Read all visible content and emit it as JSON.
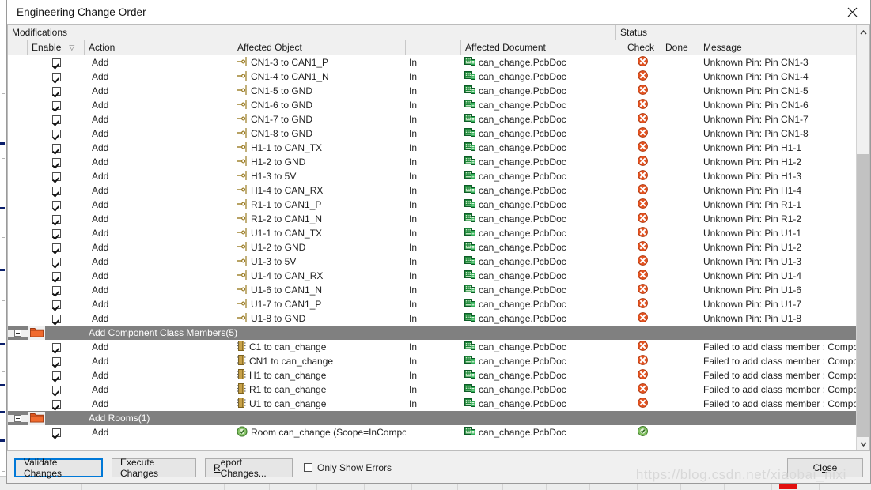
{
  "window": {
    "title": "Engineering Change Order",
    "close_icon": "close-icon"
  },
  "grid": {
    "group_headers": [
      {
        "label": "Modifications"
      },
      {
        "label": "Status"
      }
    ],
    "columns": [
      {
        "key": "enable",
        "label": "Enable",
        "sort_indicator": "▽"
      },
      {
        "key": "action",
        "label": "Action"
      },
      {
        "key": "object",
        "label": "Affected Object"
      },
      {
        "key": "in",
        "label": ""
      },
      {
        "key": "document",
        "label": "Affected Document"
      },
      {
        "key": "check",
        "label": "Check"
      },
      {
        "key": "done",
        "label": "Done"
      },
      {
        "key": "message",
        "label": "Message"
      }
    ],
    "scrollbar": {
      "up_arrow": "chevron-up-icon",
      "down_arrow": "chevron-down-icon"
    },
    "rows": [
      {
        "type": "item",
        "enabled": true,
        "action": "Add",
        "object_icon": "net-pin-icon",
        "object": "CN1-3 to CAN1_P",
        "in": "In",
        "doc_icon": "pcbdoc-icon",
        "document": "can_change.PcbDoc",
        "check": "error-icon",
        "done": "",
        "message": "Unknown Pin: Pin CN1-3"
      },
      {
        "type": "item",
        "enabled": true,
        "action": "Add",
        "object_icon": "net-pin-icon",
        "object": "CN1-4 to CAN1_N",
        "in": "In",
        "doc_icon": "pcbdoc-icon",
        "document": "can_change.PcbDoc",
        "check": "error-icon",
        "done": "",
        "message": "Unknown Pin: Pin CN1-4"
      },
      {
        "type": "item",
        "enabled": true,
        "action": "Add",
        "object_icon": "net-pin-icon",
        "object": "CN1-5 to GND",
        "in": "In",
        "doc_icon": "pcbdoc-icon",
        "document": "can_change.PcbDoc",
        "check": "error-icon",
        "done": "",
        "message": "Unknown Pin: Pin CN1-5"
      },
      {
        "type": "item",
        "enabled": true,
        "action": "Add",
        "object_icon": "net-pin-icon",
        "object": "CN1-6 to GND",
        "in": "In",
        "doc_icon": "pcbdoc-icon",
        "document": "can_change.PcbDoc",
        "check": "error-icon",
        "done": "",
        "message": "Unknown Pin: Pin CN1-6"
      },
      {
        "type": "item",
        "enabled": true,
        "action": "Add",
        "object_icon": "net-pin-icon",
        "object": "CN1-7 to GND",
        "in": "In",
        "doc_icon": "pcbdoc-icon",
        "document": "can_change.PcbDoc",
        "check": "error-icon",
        "done": "",
        "message": "Unknown Pin: Pin CN1-7"
      },
      {
        "type": "item",
        "enabled": true,
        "action": "Add",
        "object_icon": "net-pin-icon",
        "object": "CN1-8 to GND",
        "in": "In",
        "doc_icon": "pcbdoc-icon",
        "document": "can_change.PcbDoc",
        "check": "error-icon",
        "done": "",
        "message": "Unknown Pin: Pin CN1-8"
      },
      {
        "type": "item",
        "enabled": true,
        "action": "Add",
        "object_icon": "net-pin-icon",
        "object": "H1-1 to CAN_TX",
        "in": "In",
        "doc_icon": "pcbdoc-icon",
        "document": "can_change.PcbDoc",
        "check": "error-icon",
        "done": "",
        "message": "Unknown Pin: Pin H1-1"
      },
      {
        "type": "item",
        "enabled": true,
        "action": "Add",
        "object_icon": "net-pin-icon",
        "object": "H1-2 to GND",
        "in": "In",
        "doc_icon": "pcbdoc-icon",
        "document": "can_change.PcbDoc",
        "check": "error-icon",
        "done": "",
        "message": "Unknown Pin: Pin H1-2"
      },
      {
        "type": "item",
        "enabled": true,
        "action": "Add",
        "object_icon": "net-pin-icon",
        "object": "H1-3 to 5V",
        "in": "In",
        "doc_icon": "pcbdoc-icon",
        "document": "can_change.PcbDoc",
        "check": "error-icon",
        "done": "",
        "message": "Unknown Pin: Pin H1-3"
      },
      {
        "type": "item",
        "enabled": true,
        "action": "Add",
        "object_icon": "net-pin-icon",
        "object": "H1-4 to CAN_RX",
        "in": "In",
        "doc_icon": "pcbdoc-icon",
        "document": "can_change.PcbDoc",
        "check": "error-icon",
        "done": "",
        "message": "Unknown Pin: Pin H1-4"
      },
      {
        "type": "item",
        "enabled": true,
        "action": "Add",
        "object_icon": "net-pin-icon",
        "object": "R1-1 to CAN1_P",
        "in": "In",
        "doc_icon": "pcbdoc-icon",
        "document": "can_change.PcbDoc",
        "check": "error-icon",
        "done": "",
        "message": "Unknown Pin: Pin R1-1"
      },
      {
        "type": "item",
        "enabled": true,
        "action": "Add",
        "object_icon": "net-pin-icon",
        "object": "R1-2 to CAN1_N",
        "in": "In",
        "doc_icon": "pcbdoc-icon",
        "document": "can_change.PcbDoc",
        "check": "error-icon",
        "done": "",
        "message": "Unknown Pin: Pin R1-2"
      },
      {
        "type": "item",
        "enabled": true,
        "action": "Add",
        "object_icon": "net-pin-icon",
        "object": "U1-1 to CAN_TX",
        "in": "In",
        "doc_icon": "pcbdoc-icon",
        "document": "can_change.PcbDoc",
        "check": "error-icon",
        "done": "",
        "message": "Unknown Pin: Pin U1-1"
      },
      {
        "type": "item",
        "enabled": true,
        "action": "Add",
        "object_icon": "net-pin-icon",
        "object": "U1-2 to GND",
        "in": "In",
        "doc_icon": "pcbdoc-icon",
        "document": "can_change.PcbDoc",
        "check": "error-icon",
        "done": "",
        "message": "Unknown Pin: Pin U1-2"
      },
      {
        "type": "item",
        "enabled": true,
        "action": "Add",
        "object_icon": "net-pin-icon",
        "object": "U1-3 to 5V",
        "in": "In",
        "doc_icon": "pcbdoc-icon",
        "document": "can_change.PcbDoc",
        "check": "error-icon",
        "done": "",
        "message": "Unknown Pin: Pin U1-3"
      },
      {
        "type": "item",
        "enabled": true,
        "action": "Add",
        "object_icon": "net-pin-icon",
        "object": "U1-4 to CAN_RX",
        "in": "In",
        "doc_icon": "pcbdoc-icon",
        "document": "can_change.PcbDoc",
        "check": "error-icon",
        "done": "",
        "message": "Unknown Pin: Pin U1-4"
      },
      {
        "type": "item",
        "enabled": true,
        "action": "Add",
        "object_icon": "net-pin-icon",
        "object": "U1-6 to CAN1_N",
        "in": "In",
        "doc_icon": "pcbdoc-icon",
        "document": "can_change.PcbDoc",
        "check": "error-icon",
        "done": "",
        "message": "Unknown Pin: Pin U1-6"
      },
      {
        "type": "item",
        "enabled": true,
        "action": "Add",
        "object_icon": "net-pin-icon",
        "object": "U1-7 to CAN1_P",
        "in": "In",
        "doc_icon": "pcbdoc-icon",
        "document": "can_change.PcbDoc",
        "check": "error-icon",
        "done": "",
        "message": "Unknown Pin: Pin U1-7"
      },
      {
        "type": "item",
        "enabled": true,
        "action": "Add",
        "object_icon": "net-pin-icon",
        "object": "U1-8 to GND",
        "in": "In",
        "doc_icon": "pcbdoc-icon",
        "document": "can_change.PcbDoc",
        "check": "error-icon",
        "done": "",
        "message": "Unknown Pin: Pin U1-8"
      },
      {
        "type": "group",
        "expander": "collapse-icon",
        "folder_icon": "folder-icon",
        "label": "Add Component Class Members(5)"
      },
      {
        "type": "item",
        "enabled": true,
        "action": "Add",
        "object_icon": "component-icon",
        "object": "C1 to can_change",
        "in": "In",
        "doc_icon": "pcbdoc-icon",
        "document": "can_change.PcbDoc",
        "check": "error-icon",
        "done": "",
        "message": "Failed to add class member : Component"
      },
      {
        "type": "item",
        "enabled": true,
        "action": "Add",
        "object_icon": "component-icon",
        "object": "CN1 to can_change",
        "in": "In",
        "doc_icon": "pcbdoc-icon",
        "document": "can_change.PcbDoc",
        "check": "error-icon",
        "done": "",
        "message": "Failed to add class member : Component"
      },
      {
        "type": "item",
        "enabled": true,
        "action": "Add",
        "object_icon": "component-icon",
        "object": "H1 to can_change",
        "in": "In",
        "doc_icon": "pcbdoc-icon",
        "document": "can_change.PcbDoc",
        "check": "error-icon",
        "done": "",
        "message": "Failed to add class member : Component"
      },
      {
        "type": "item",
        "enabled": true,
        "action": "Add",
        "object_icon": "component-icon",
        "object": "R1 to can_change",
        "in": "In",
        "doc_icon": "pcbdoc-icon",
        "document": "can_change.PcbDoc",
        "check": "error-icon",
        "done": "",
        "message": "Failed to add class member : Component"
      },
      {
        "type": "item",
        "enabled": true,
        "action": "Add",
        "object_icon": "component-icon",
        "object": "U1 to can_change",
        "in": "In",
        "doc_icon": "pcbdoc-icon",
        "document": "can_change.PcbDoc",
        "check": "error-icon",
        "done": "",
        "message": "Failed to add class member : Component"
      },
      {
        "type": "group",
        "expander": "collapse-icon",
        "folder_icon": "folder-icon",
        "label": "Add Rooms(1)"
      },
      {
        "type": "item",
        "enabled": true,
        "action": "Add",
        "object_icon": "room-icon",
        "object": "Room can_change (Scope=InCompor To",
        "in": "",
        "doc_icon": "pcbdoc-icon",
        "document": "can_change.PcbDoc",
        "check": "success-icon",
        "done": "",
        "message": ""
      }
    ]
  },
  "footer": {
    "validate_label": "Validate Changes",
    "execute_label": "Execute Changes",
    "report_label": "Report Changes...",
    "only_show_errors_label": "Only Show Errors",
    "only_show_errors_checked": false,
    "close_label": "Close"
  },
  "watermark": "https://blog.csdn.net/xiaobai_nixi",
  "colors": {
    "group_row_bg": "#808080",
    "error": "#e2511f",
    "success": "#5faa3c",
    "accent": "#0078d7",
    "folder": "#e1571f",
    "pcbdoc": "#1f8a3b",
    "component": "#c8a24a"
  }
}
